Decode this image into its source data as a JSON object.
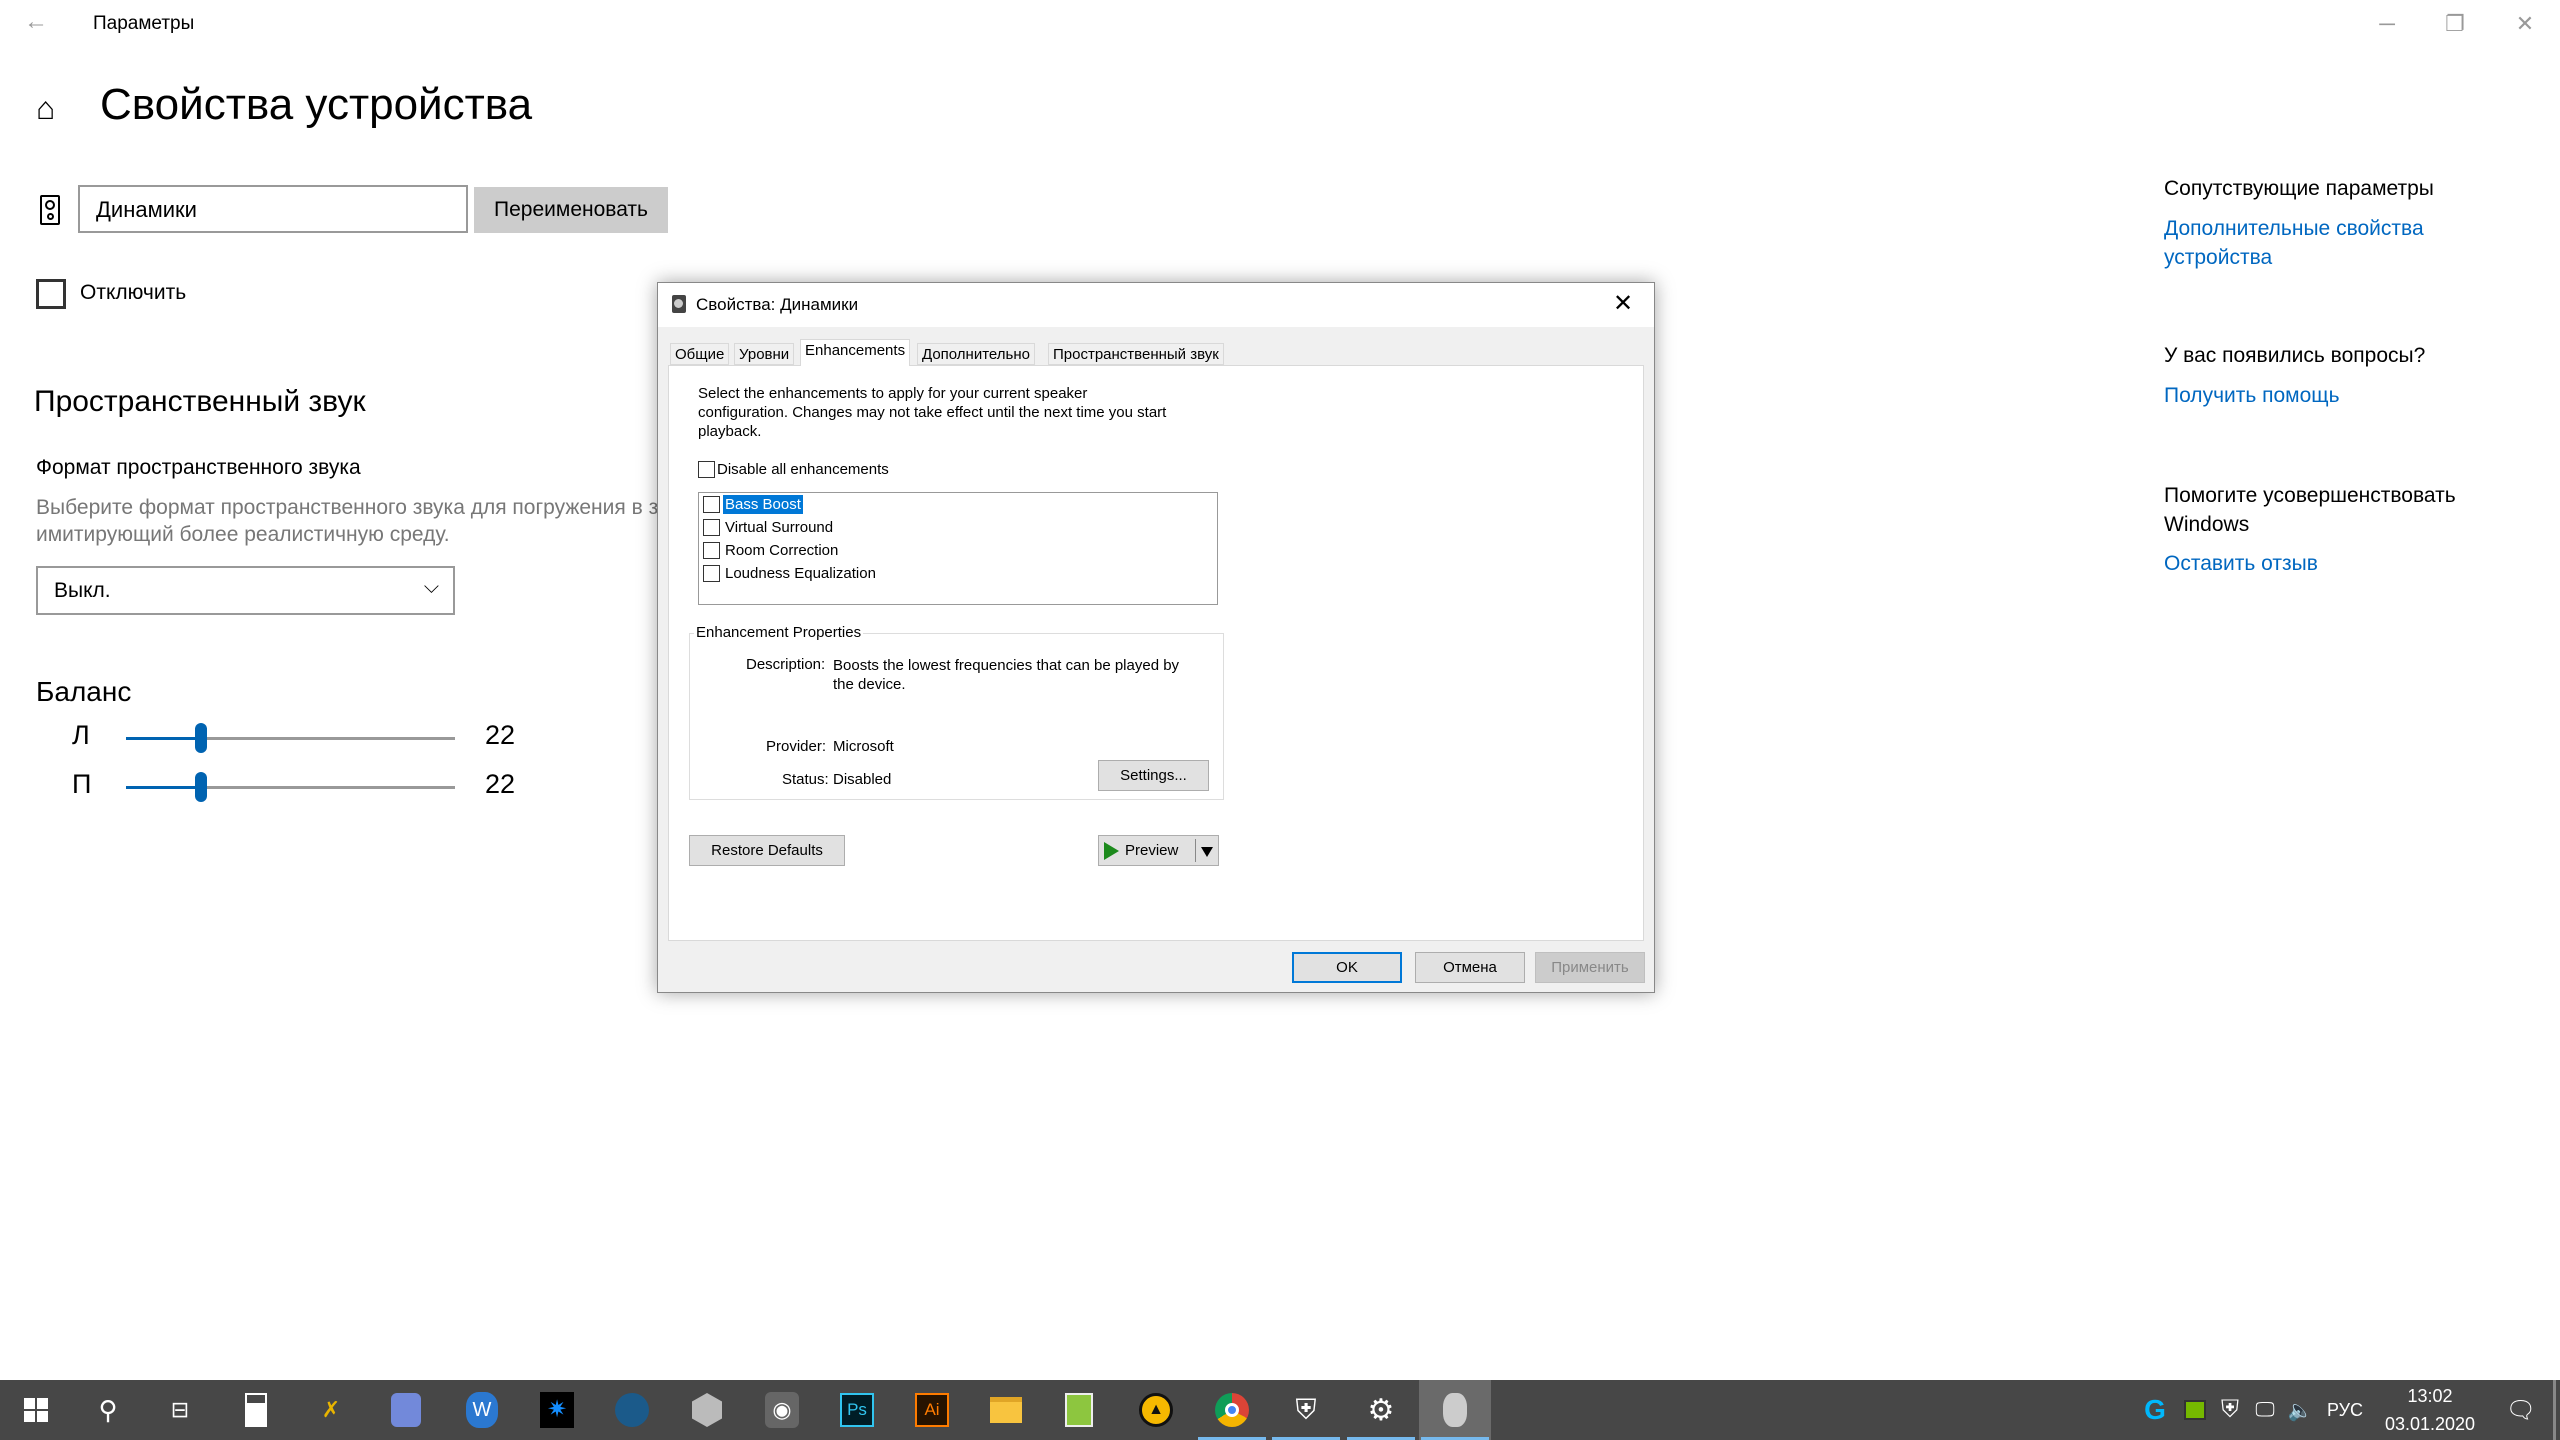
{
  "window": {
    "title": "Параметры",
    "back_icon": "back-arrow-icon",
    "minimize": "─",
    "maximize": "❐",
    "close": "✕"
  },
  "page": {
    "title": "Свойства устройства",
    "device_name": "Динамики",
    "rename_label": "Переименовать",
    "disable_label": "Отключить",
    "disable_checked": false
  },
  "spatial": {
    "heading": "Пространственный звук",
    "format_label": "Формат пространственного звука",
    "description_line1": "Выберите формат пространственного звука для погружения в звуковую среду,",
    "description_line2": "имитирующий более реалистичную среду.",
    "selected": "Выкл."
  },
  "balance": {
    "heading": "Баланс",
    "left_label": "Л",
    "left_value": "22",
    "right_label": "П",
    "right_value": "22"
  },
  "related": {
    "heading": "Сопутствующие параметры",
    "link1_line1": "Дополнительные свойства",
    "link1_line2": "устройства",
    "questions_heading": "У вас появились вопросы?",
    "help_link": "Получить помощь",
    "improve_line1": "Помогите усовершенствовать",
    "improve_line2": "Windows",
    "feedback_link": "Оставить отзыв"
  },
  "dialog": {
    "title": "Свойства: Динамики",
    "tabs": [
      "Общие",
      "Уровни",
      "Enhancements",
      "Дополнительно",
      "Пространственный звук"
    ],
    "active_tab": "Enhancements",
    "intro_line1": "Select the enhancements to apply for your current speaker",
    "intro_line2": "configuration. Changes may not take effect until the next time you start",
    "intro_line3": "playback.",
    "disable_all": "Disable all enhancements",
    "enhancements": [
      "Bass Boost",
      "Virtual Surround",
      "Room Correction",
      "Loudness Equalization"
    ],
    "selected_enhancement": "Bass Boost",
    "group_title": "Enhancement Properties",
    "description_label": "Description:",
    "description_line1": "Boosts the lowest frequencies that can be played by",
    "description_line2": "the device.",
    "provider_label": "Provider:",
    "provider": "Microsoft",
    "status_label": "Status:",
    "status": "Disabled",
    "settings_button": "Settings...",
    "restore_button": "Restore Defaults",
    "preview_button": "Preview",
    "ok": "OK",
    "cancel": "Отмена",
    "apply": "Применить"
  },
  "taskbar": {
    "icons": [
      "start",
      "search",
      "task-view",
      "calculator",
      "app-tool",
      "discord",
      "word-app",
      "battlenet",
      "steam",
      "unity",
      "obs",
      "photoshop",
      "illustrator",
      "file-explorer",
      "notepad-plus",
      "aimp",
      "chrome",
      "defender",
      "settings",
      "sound"
    ],
    "active": [
      "chrome",
      "defender",
      "settings",
      "sound"
    ],
    "ps": "Ps",
    "ai": "Ai",
    "lang": "РУС",
    "time": "13:02",
    "date": "03.01.2020"
  }
}
